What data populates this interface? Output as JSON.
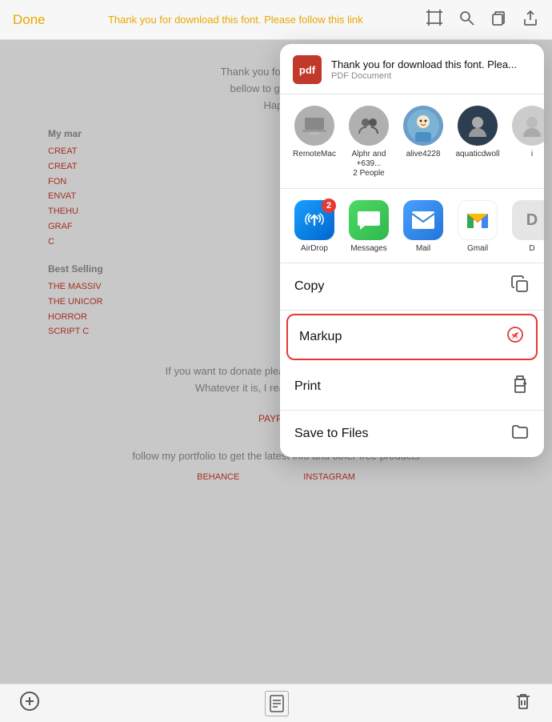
{
  "topbar": {
    "done_label": "Done",
    "title": "Thank you for download this font. Please follow this link",
    "icons": [
      "crop-icon",
      "search-icon",
      "duplicate-icon",
      "share-icon"
    ]
  },
  "share_panel": {
    "pdf_label": "pdf",
    "file_title": "Thank you for download this font. Plea...",
    "file_subtitle": "PDF Document",
    "people": [
      {
        "name": "RemoteMac",
        "type": "mac"
      },
      {
        "name": "Alphr and +639...\n2 People",
        "type": "people"
      },
      {
        "name": "alive4228",
        "type": "alive"
      },
      {
        "name": "aquaticdwoll",
        "type": "aquatic"
      },
      {
        "name": "i",
        "type": "extra"
      }
    ],
    "apps": [
      {
        "name": "AirDrop",
        "type": "airdrop",
        "badge": "2"
      },
      {
        "name": "Messages",
        "type": "messages"
      },
      {
        "name": "Mail",
        "type": "mail"
      },
      {
        "name": "Gmail",
        "type": "gmail"
      },
      {
        "name": "D",
        "type": "extra"
      }
    ],
    "actions": [
      {
        "label": "Copy",
        "icon": "copy-icon"
      },
      {
        "label": "Markup",
        "icon": "markup-icon",
        "highlighted": true
      },
      {
        "label": "Print",
        "icon": "print-icon"
      },
      {
        "label": "Save to Files",
        "icon": "folder-icon"
      }
    ]
  },
  "doc": {
    "intro_text": "Thank you for download\nbellow to get helpful\nHapp",
    "my_marketplace_label": "My mar",
    "links": [
      "CREAT",
      "CREAT",
      "FON",
      "ENVAT",
      "THEHU",
      "GRAF",
      "C"
    ],
    "best_selling_label": "Best Selling",
    "best_links": [
      "THE MASSIV",
      "THE UNICOR",
      "HORROR",
      "SCRIPT C"
    ],
    "donate_text": "If you want to donate please click the link below.\nWhatever it is, I really appreciate it.",
    "paypal_label": "PAYPAL",
    "follow_text": "follow my portfolio to get the latest info and other free products",
    "social": [
      "BEHANCE",
      "INSTAGRAM"
    ]
  },
  "bottom": {
    "add_icon": "plus-icon",
    "thumbnail_icon": "page-icon",
    "delete_icon": "trash-icon"
  }
}
